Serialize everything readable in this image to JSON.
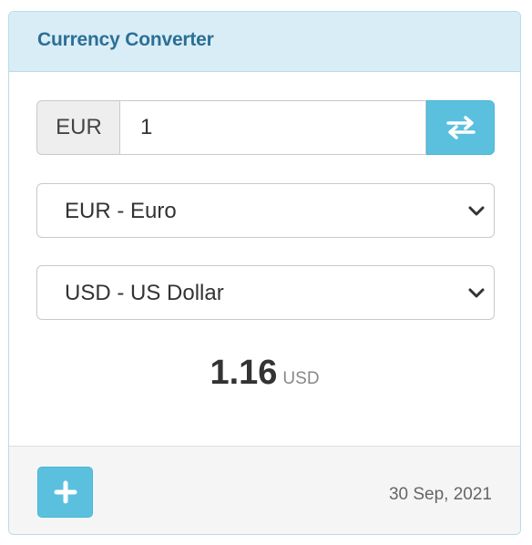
{
  "header": {
    "title": "Currency Converter"
  },
  "converter": {
    "base_currency_code": "EUR",
    "amount": "1",
    "from_currency": "EUR - Euro",
    "to_currency": "USD - US Dollar",
    "result_value": "1.16",
    "result_unit": "USD"
  },
  "footer": {
    "date": "30 Sep, 2021"
  },
  "icons": {
    "swap": "swap-arrows-icon",
    "chevron": "chevron-down-icon",
    "add": "plus-icon"
  },
  "colors": {
    "header_bg": "#d9edf7",
    "title": "#2c6f95",
    "accent_button": "#5bc0de"
  }
}
